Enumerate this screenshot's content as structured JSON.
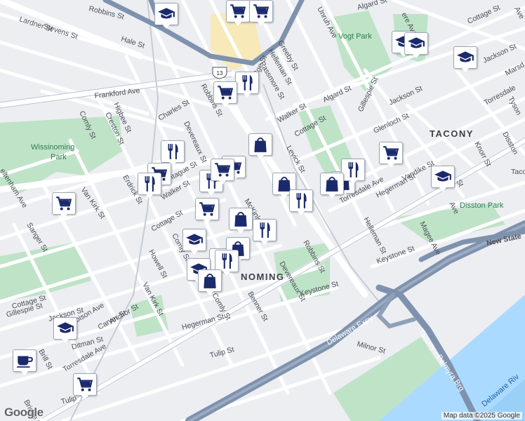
{
  "map": {
    "attribution": "Map data ©2025 Google",
    "logo": "Google",
    "neighborhoods": {
      "tacony": "TACONY",
      "wissinoming": "NOMING",
      "tacony_right": "Tacon"
    },
    "parks": {
      "vogt": "Vogt Park",
      "wissinoming_1": "Wissinoming",
      "wissinoming_2": "Park",
      "disston": "Disston Park"
    },
    "highways": {
      "us13": "13",
      "delaware_expy": "Delaware Expy",
      "tacony_palmyra": "Tacony - Palmyra Brg",
      "new_state": "New State"
    },
    "water": {
      "river": "Delaware Riv"
    },
    "streets": {
      "robbins_top": "Robbins St",
      "lardner": "Lardner St",
      "stevens": "Stevens St",
      "hale": "Hale St",
      "frankford": "Frankford Ave",
      "comly_w": "Comly St",
      "higbee": "Higbee St",
      "creston": "Creston St",
      "charles": "Charles St",
      "devereaux_n": "Devereaux St",
      "erdrick": "Erdrick St",
      "montague": "Montague St",
      "walker_w": "Walker St",
      "van_kirk_w": "Van Kirk St",
      "sanger": "Sanger St",
      "cheltenham": "eltenham Ave",
      "cottage_c": "Cottage St",
      "comly_c": "Comly St",
      "howell": "Howell St",
      "van_kirk_s": "Van Kirk St",
      "cottage_sw": "Cottage St",
      "gillespie_sw": "Gillespie St",
      "jackson_sw": "Jackson St",
      "harbison": "Harbison Ave",
      "anchor": "Anchor St",
      "carver": "Carver St",
      "ditman": "Ditman St",
      "torresdale_sw": "Torresdale Ave",
      "brill": "Brill St",
      "tulip_sw": "Tulip",
      "bridge": "Bridge St",
      "geeby": "Greeby St",
      "helleman_n": "Helleman St",
      "passmore": "Passmore St",
      "bridge_n": "Bridge St",
      "walker_c": "Walker St",
      "cottage_n": "Cottage St",
      "levick": "Levick St",
      "mckinley": "McKinley",
      "robbins_c": "Robbins St",
      "robbins_s": "Robbins St",
      "devereaux_s": "Devereaux St",
      "comly_s": "Comly St",
      "benner": "Benner St",
      "hegerman_s": "Hegerman St",
      "tulip_s": "Tulip St",
      "keystone_c": "Keystone St",
      "keystone_e": "Keystone St",
      "unruh": "Unruh Ave",
      "algard_n": "Algard St",
      "algard": "Algard St",
      "cottage_ne": "Cottage St",
      "jackson_ne": "Jackson St",
      "gillespie_n": "Gillespie St",
      "jackson_n": "Jackson St",
      "glenloch": "Glenloch St",
      "torresdale_e": "Torresdale Ave",
      "torresdale_ne": "Torresdale",
      "tyson": "Tyson",
      "marsden": "Marsd",
      "disston_st": "Disston",
      "knorr": "Knorr St",
      "ave_e": "Ave",
      "vandike": "Vandike St",
      "hegerman_e": "Hegerman St",
      "helleman_e": "Helleman St",
      "magee": "Magee Ave",
      "milnor": "Milnor St",
      "revere": "ere Ave",
      "rhawn": "St",
      "roosevelt": "Ave"
    },
    "pins": [
      {
        "type": "school",
        "icon": "graduation-cap"
      },
      {
        "type": "grocery",
        "icon": "shopping-cart"
      },
      {
        "type": "grocery",
        "icon": "shopping-cart"
      },
      {
        "type": "restaurant",
        "icon": "fork-knife"
      },
      {
        "type": "grocery",
        "icon": "shopping-cart"
      },
      {
        "type": "school",
        "icon": "graduation-cap"
      },
      {
        "type": "school",
        "icon": "graduation-cap"
      },
      {
        "type": "school",
        "icon": "graduation-cap"
      },
      {
        "type": "shopping",
        "icon": "shopping-bag"
      },
      {
        "type": "restaurant",
        "icon": "fork-knife"
      },
      {
        "type": "grocery",
        "icon": "shopping-cart"
      },
      {
        "type": "grocery",
        "icon": "shopping-cart"
      },
      {
        "type": "grocery",
        "icon": "shopping-cart"
      },
      {
        "type": "shopping",
        "icon": "shopping-bag"
      },
      {
        "type": "restaurant",
        "icon": "fork-knife"
      },
      {
        "type": "restaurant",
        "icon": "fork-knife"
      },
      {
        "type": "grocery",
        "icon": "shopping-cart"
      },
      {
        "type": "school",
        "icon": "graduation-cap"
      },
      {
        "type": "restaurant",
        "icon": "fork-knife"
      },
      {
        "type": "grocery",
        "icon": "shopping-cart"
      },
      {
        "type": "shopping",
        "icon": "shopping-bag"
      },
      {
        "type": "restaurant",
        "icon": "fork-knife"
      },
      {
        "type": "shopping",
        "icon": "shopping-bag"
      },
      {
        "type": "shopping",
        "icon": "shopping-bag"
      },
      {
        "type": "restaurant",
        "icon": "fork-knife"
      },
      {
        "type": "school",
        "icon": "graduation-cap"
      },
      {
        "type": "grocery",
        "icon": "shopping-cart"
      },
      {
        "type": "restaurant",
        "icon": "fork-knife"
      },
      {
        "type": "shopping",
        "icon": "shopping-bag"
      },
      {
        "type": "school",
        "icon": "graduation-cap"
      },
      {
        "type": "restaurant",
        "icon": "fork-knife"
      },
      {
        "type": "shopping",
        "icon": "shopping-bag"
      },
      {
        "type": "school",
        "icon": "graduation-cap"
      },
      {
        "type": "cafe",
        "icon": "coffee-cup"
      },
      {
        "type": "grocery",
        "icon": "shopping-cart"
      }
    ],
    "colors": {
      "pin_icon": "#1a2a6c",
      "park": "#bfe3c7",
      "water": "#aadaff",
      "highway": "#7f92ad",
      "land": "#eceef2"
    }
  }
}
